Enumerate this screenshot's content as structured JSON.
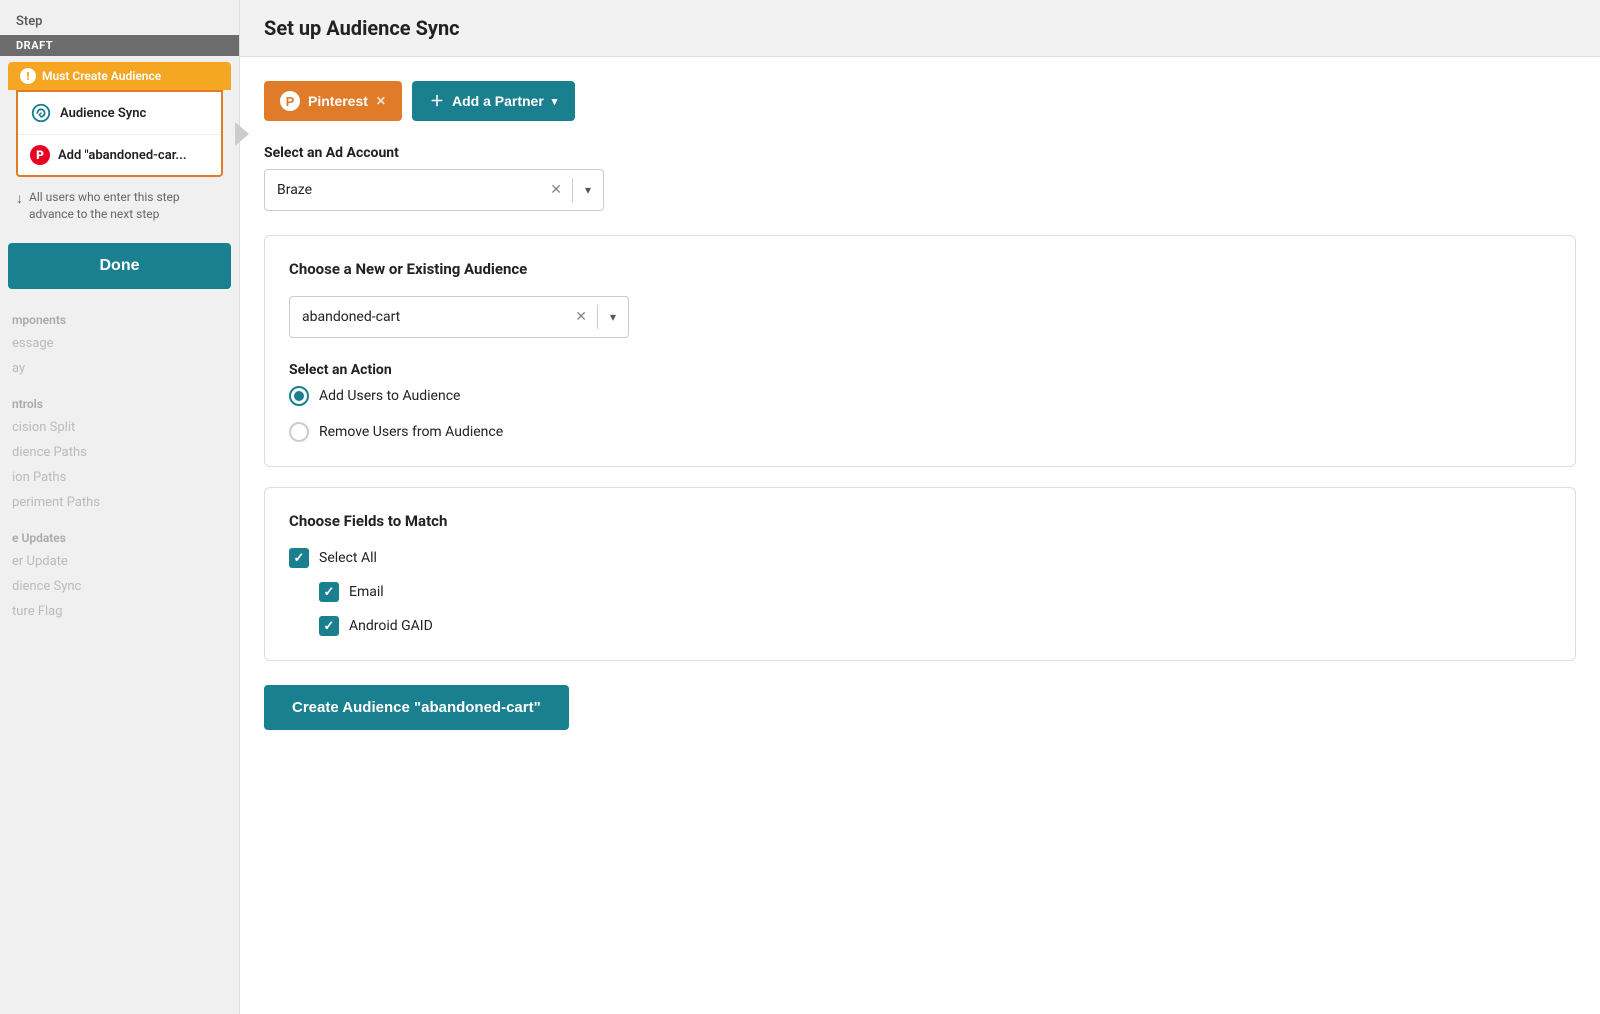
{
  "sidebar": {
    "step_label": "Step",
    "draft_badge": "DRAFT",
    "must_create_label": "Must Create Audience",
    "audience_sync_label": "Audience Sync",
    "add_pinterest_label": "Add \"abandoned-car...",
    "advance_text": "All users who enter this step advance to the next step",
    "done_button": "Done",
    "nav": {
      "components_label": "mponents",
      "message_label": "essage",
      "delay_label": "ay",
      "controls_label": "ntrols",
      "decision_split_label": "cision Split",
      "audience_paths_label": "dience Paths",
      "action_paths_label": "ion Paths",
      "experiment_paths_label": "periment Paths",
      "user_updates_label": "e Updates",
      "user_update_label": "er Update",
      "audience_sync_label": "dience Sync",
      "feature_flag_label": "ture Flag"
    }
  },
  "main": {
    "title": "Set up Audience Sync",
    "partner_pinterest_label": "Pinterest",
    "partner_add_label": "Add a Partner",
    "select_ad_account_label": "Select an Ad Account",
    "ad_account_value": "Braze",
    "choose_audience_label": "Choose a New or Existing Audience",
    "audience_value": "abandoned-cart",
    "select_action_label": "Select an Action",
    "action_options": [
      {
        "label": "Add Users to Audience",
        "selected": true
      },
      {
        "label": "Remove Users from Audience",
        "selected": false
      }
    ],
    "choose_fields_label": "Choose Fields to Match",
    "select_all_label": "Select All",
    "fields": [
      {
        "label": "Email",
        "checked": true
      },
      {
        "label": "Android GAID",
        "checked": true
      }
    ],
    "create_button": "Create Audience \"abandoned-cart\""
  }
}
